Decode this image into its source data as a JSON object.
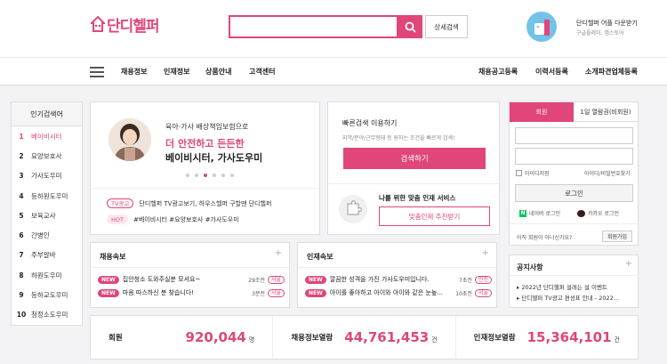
{
  "brand": {
    "name": "단디헬퍼",
    "accent": "#e0467a"
  },
  "header": {
    "detail_search": "상세검색",
    "app_line1": "단디헬퍼 어플 다운받기",
    "app_line2": "구글플레이, 앱스토어"
  },
  "nav": {
    "left": [
      "채용정보",
      "인재정보",
      "상품안내",
      "고객센터"
    ],
    "right": [
      "채용공고등록",
      "이력서등록",
      "소개파견업체등록"
    ]
  },
  "popular": {
    "title": "인기검색어",
    "items": [
      {
        "rank": "1",
        "label": "베이비시터"
      },
      {
        "rank": "2",
        "label": "요양보호사"
      },
      {
        "rank": "3",
        "label": "가사도우미"
      },
      {
        "rank": "4",
        "label": "등하원도우미"
      },
      {
        "rank": "5",
        "label": "보육교사"
      },
      {
        "rank": "6",
        "label": "간병인"
      },
      {
        "rank": "7",
        "label": "주부알바"
      },
      {
        "rank": "8",
        "label": "하원도우미"
      },
      {
        "rank": "9",
        "label": "등하교도우미"
      },
      {
        "rank": "10",
        "label": "청정소도우미"
      }
    ]
  },
  "promo": {
    "subtitle": "육아·가사 배상책임보험으로",
    "title_line1": "더 안전하고 든든한",
    "title_line2": "베이비시터, 가사도우미",
    "tv_tag": "TV광고",
    "tv_text": "단디헬퍼 TV광고보기, 하우스헬퍼 구할땐 단디헬퍼",
    "hot_tag": "HOT",
    "hot_text": "#베이비시터 #요양보호사 #가사도우미"
  },
  "quick": {
    "title": "빠른검색 이용하기",
    "desc": "지역/분야/근무형태 등 원하는 조건을 빠르게 검색!",
    "button": "검색하기",
    "match_title": "나를 위한 맞춤 인재 서비스",
    "match_button": "맞춤인재 추천받기"
  },
  "login": {
    "tab_member": "회원",
    "tab_day": "1일 열람권(비회원)",
    "save_id": "아이디저장",
    "find": "아이디/비밀번호찾기",
    "login_button": "로그인",
    "naver": "네이버 로그인",
    "kakao": "카카오 로그인",
    "not_member": "아직 회원이 아니신가요?",
    "join": "회원가입"
  },
  "notice": {
    "title": "공지사항",
    "items": [
      "2022년 단디헬퍼 설레는 설 이벤트",
      "단디헬퍼 TV광고 편성표 안내 - 2022..."
    ]
  },
  "job_news": {
    "title": "채용속보",
    "items": [
      {
        "badge": "NEW",
        "text": "집안청소 도와주실분 모셔요~",
        "count": "29조전",
        "region": "서울"
      },
      {
        "badge": "NEW",
        "text": "마음 따스하신 분 찾습니다!",
        "count": "3분전",
        "region": "서울"
      }
    ]
  },
  "talent_news": {
    "title": "인재속보",
    "items": [
      {
        "badge": "NEW",
        "text": "깔끔한 성격을 가진 가사도우미입니다.",
        "count": "7초전",
        "region": "인천"
      },
      {
        "badge": "NEW",
        "text": "아이를 좋아하고 아이와 아이와 같은 눈높...",
        "count": "10초전",
        "region": "서울"
      }
    ]
  },
  "stats": [
    {
      "label": "회원",
      "value": "920,044",
      "unit": "명"
    },
    {
      "label": "채용정보열람",
      "value": "44,761,453",
      "unit": "건"
    },
    {
      "label": "인재정보열람",
      "value": "15,364,101",
      "unit": "건"
    }
  ]
}
